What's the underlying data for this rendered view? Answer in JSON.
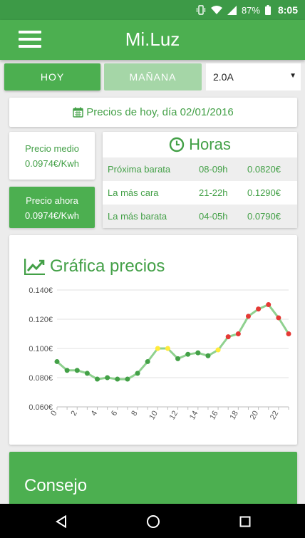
{
  "status_bar": {
    "battery": "87%",
    "time": "8:05",
    "icons": [
      "vibrate-icon",
      "wifi-icon",
      "signal-icon",
      "battery-icon"
    ]
  },
  "app_bar": {
    "title": "Mi.Luz",
    "menu_icon": "hamburger-menu-icon"
  },
  "tabs": [
    {
      "label": "Hoy",
      "active": true
    },
    {
      "label": "Mañana",
      "active": false
    }
  ],
  "tariff": {
    "selected": "2.0A",
    "caret": "▼"
  },
  "date_header": {
    "icon": "calendar-icon",
    "text": "Precios de hoy, día 02/01/2016"
  },
  "average": {
    "label": "Precio medio",
    "value": "0.0974€/Kwh"
  },
  "current": {
    "label": "Precio ahora",
    "value": "0.0974€/Kwh"
  },
  "hours": {
    "title": "Horas",
    "icon": "clock-icon",
    "rows": [
      {
        "label": "Próxima barata",
        "range": "08-09h",
        "price": "0.0820€"
      },
      {
        "label": "La más cara",
        "range": "21-22h",
        "price": "0.1290€"
      },
      {
        "label": "La más barata",
        "range": "04-05h",
        "price": "0.0790€"
      }
    ]
  },
  "chart_title": "Gráfica precios",
  "chart_icon": "trending-up-icon",
  "chart_data": {
    "type": "line",
    "x": [
      0,
      1,
      2,
      3,
      4,
      5,
      6,
      7,
      8,
      9,
      10,
      11,
      12,
      13,
      14,
      15,
      16,
      17,
      18,
      19,
      20,
      21,
      22,
      23
    ],
    "x_tick_labels": [
      "0",
      "2",
      "4",
      "6",
      "8",
      "10",
      "12",
      "14",
      "16",
      "18",
      "20",
      "22"
    ],
    "y_tick_labels": [
      "0.140€",
      "0.120€",
      "0.100€",
      "0.080€",
      "0.060€"
    ],
    "series": [
      {
        "values": [
          0.091,
          0.085,
          0.085,
          0.083,
          0.079,
          0.08,
          0.079,
          0.079,
          0.083,
          0.091,
          0.1,
          0.1,
          0.093,
          0.096,
          0.097,
          0.095,
          0.099,
          0.108,
          0.11,
          0.122,
          0.127,
          0.13,
          0.121,
          0.11
        ]
      }
    ],
    "point_levels": [
      "low",
      "low",
      "low",
      "low",
      "low",
      "low",
      "low",
      "low",
      "low",
      "low",
      "mid",
      "mid",
      "low",
      "low",
      "low",
      "low",
      "mid",
      "high",
      "high",
      "high",
      "high",
      "high",
      "high",
      "high"
    ],
    "ylim": [
      0.06,
      0.14
    ],
    "xlim": [
      0,
      23
    ],
    "grid": true,
    "line_color": "#8fd18f",
    "level_colors": {
      "low": "#43a047",
      "mid": "#ffeb3b",
      "high": "#e53935"
    }
  },
  "advice": {
    "title": "Consejo"
  },
  "colors": {
    "primary": "#4caf50",
    "primary_dark": "#3d9a47",
    "primary_light": "#a5d6a7",
    "text_green": "#43a047"
  },
  "nav": {
    "back": "back-icon",
    "home": "home-icon",
    "recents": "recents-icon"
  }
}
